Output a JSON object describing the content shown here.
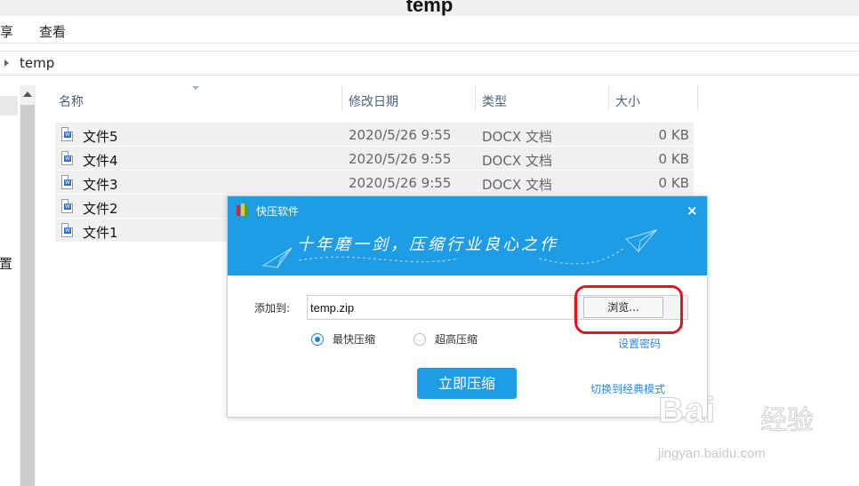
{
  "window": {
    "title": "temp"
  },
  "menu": {
    "items": [
      "享",
      "查看"
    ]
  },
  "address": {
    "crumb": "temp"
  },
  "navpane": {
    "fragment": "置"
  },
  "columns": {
    "name": "名称",
    "date": "修改日期",
    "type": "类型",
    "size": "大小"
  },
  "files": [
    {
      "name": "文件5",
      "date": "2020/5/26 9:55",
      "type": "DOCX 文档",
      "size": "0 KB"
    },
    {
      "name": "文件4",
      "date": "2020/5/26 9:55",
      "type": "DOCX 文档",
      "size": "0 KB"
    },
    {
      "name": "文件3",
      "date": "2020/5/26 9:55",
      "type": "DOCX 文档",
      "size": "0 KB"
    },
    {
      "name": "文件2"
    },
    {
      "name": "文件1"
    }
  ],
  "dialog": {
    "title": "快压软件",
    "close_glyph": "×",
    "slogan": "十年磨一剑，压缩行业良心之作",
    "add_to_label": "添加到:",
    "path_value": "temp.zip",
    "browse_label": "浏览...",
    "option_fast": "最快压缩",
    "option_high": "超高压缩",
    "selected_option": "最快压缩",
    "set_password": "设置密码",
    "compress_button": "立即压缩",
    "classic_mode": "切换到经典模式",
    "colors": {
      "header": "#1e9ce6",
      "button": "#1f9ce6",
      "highlight": "#e0171e",
      "link": "#2d8ae0"
    }
  },
  "watermark": {
    "brand_latin": "Bai",
    "brand_cn": "经验",
    "url": "jingyan.baidu.com"
  }
}
